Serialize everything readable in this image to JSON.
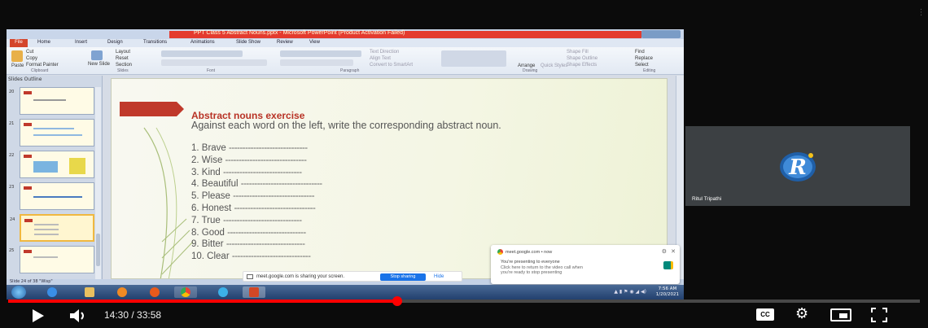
{
  "powerpoint": {
    "window_title": "PPT Class 5 Abstract Nouns.pptx - Microsoft PowerPoint (Product Activation Failed)",
    "tabs": [
      "File",
      "Home",
      "Insert",
      "Design",
      "Transitions",
      "Animations",
      "Slide Show",
      "Review",
      "View"
    ],
    "ribbon": {
      "clipboard": [
        "Cut",
        "Copy",
        "Format Painter"
      ],
      "paste": "Paste",
      "new_slide": "New Slide",
      "slides_group": [
        "Layout",
        "Reset",
        "Section"
      ],
      "paragraph_group": [
        "Text Direction",
        "Align Text",
        "Convert to SmartArt"
      ],
      "arrange": "Arrange",
      "quick_styles": "Quick Styles",
      "drawing_group": [
        "Shape Fill",
        "Shape Outline",
        "Shape Effects"
      ],
      "editing_group": [
        "Find",
        "Replace",
        "Select"
      ],
      "group_labels": [
        "Clipboard",
        "Slides",
        "Font",
        "Paragraph",
        "Drawing",
        "Editing"
      ]
    },
    "side_tabs": "Slides   Outline",
    "thumb_numbers": [
      "20",
      "21",
      "22",
      "23",
      "24",
      "25"
    ],
    "status": "Slide 24 of 38   \"Wisp\"",
    "slide": {
      "title": "Abstract nouns exercise",
      "subtitle": "Against each word on the left, write the corresponding abstract noun.",
      "items": [
        {
          "label": "1. Brave",
          "dash": "-----------------------------"
        },
        {
          "label": "2. Wise",
          "dash": "------------------------------"
        },
        {
          "label": "3. Kind",
          "dash": "-----------------------------"
        },
        {
          "label": "4. Beautiful",
          "dash": "------------------------------"
        },
        {
          "label": "5. Please",
          "dash": "------------------------------"
        },
        {
          "label": "6. Honest",
          "dash": "------------------------------"
        },
        {
          "label": "7. True",
          "dash": "-----------------------------"
        },
        {
          "label": "8. Good",
          "dash": "-----------------------------"
        },
        {
          "label": "9. Bitter",
          "dash": "-----------------------------"
        },
        {
          "label": "10. Clear",
          "dash": "-----------------------------"
        }
      ]
    }
  },
  "share_bar": {
    "text": "meet.google.com is sharing your screen.",
    "stop_label": "Stop sharing",
    "hide_label": "Hide"
  },
  "meet_toast": {
    "header": "meet.google.com • now",
    "line1": "You're presenting to everyone",
    "line2": "Click here to return to the video call when",
    "line3": "you're ready to stop presenting"
  },
  "taskbar": {
    "time": "7:56 AM",
    "date": "1/20/2021"
  },
  "participant": {
    "name": "Ritul Tripathi"
  },
  "player": {
    "time_display": "14:30 / 33:58",
    "progress_fraction": 0.4269,
    "cc_label": "CC",
    "accent": "#ff0000"
  }
}
